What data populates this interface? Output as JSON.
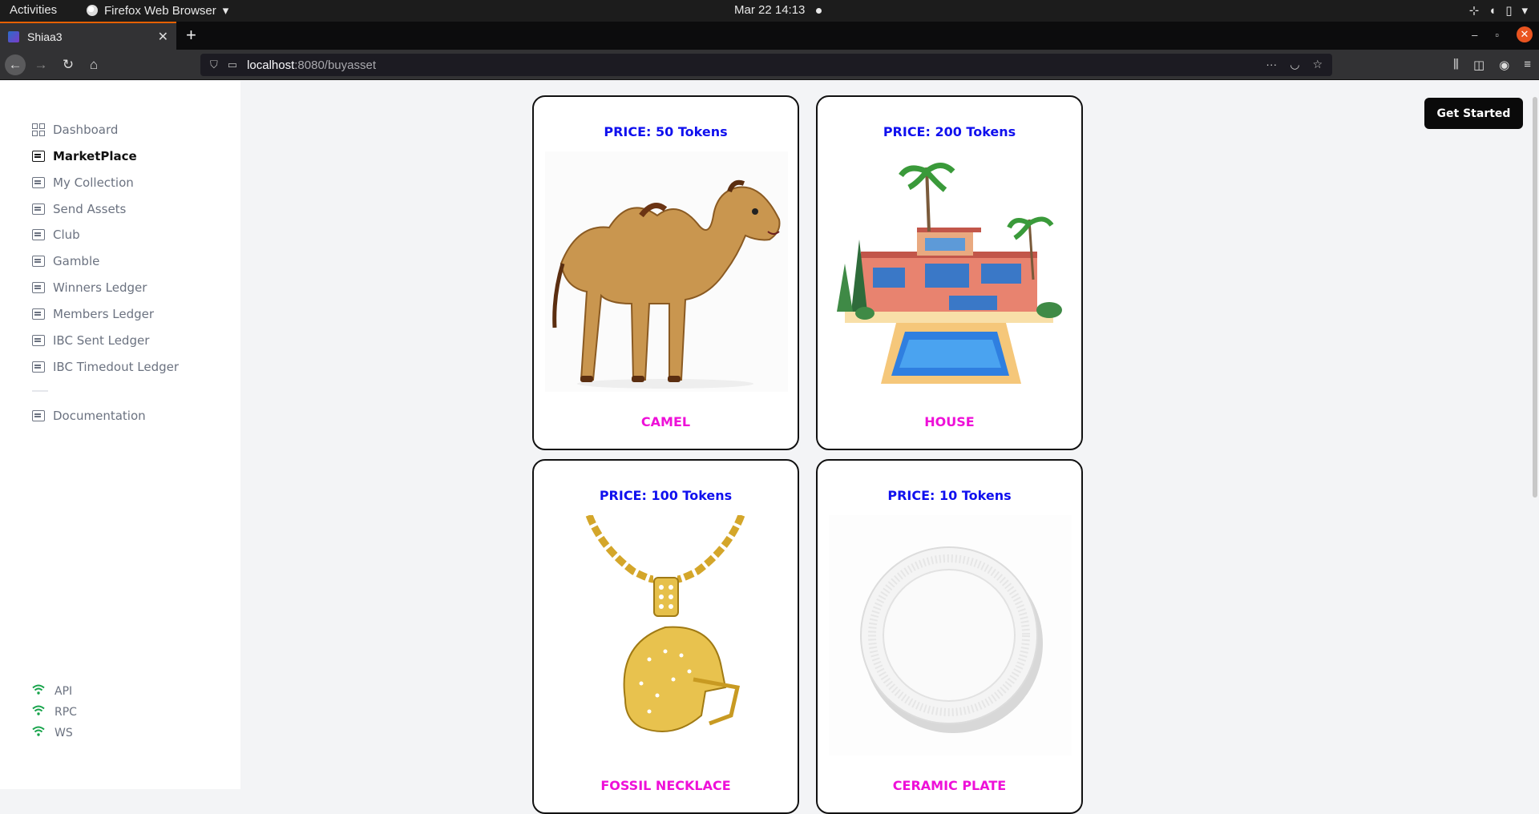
{
  "system": {
    "activities": "Activities",
    "app_menu": "Firefox Web Browser",
    "clock": "Mar 22  14:13"
  },
  "browser": {
    "tab_title": "Shiaa3",
    "url_host": "localhost",
    "url_rest": ":8080/buyasset"
  },
  "sidebar": {
    "items": [
      {
        "label": "Dashboard",
        "icon": "grid-icon",
        "active": false
      },
      {
        "label": "MarketPlace",
        "icon": "list-icon",
        "active": true
      },
      {
        "label": "My Collection",
        "icon": "list-icon",
        "active": false
      },
      {
        "label": "Send Assets",
        "icon": "list-icon",
        "active": false
      },
      {
        "label": "Club",
        "icon": "list-icon",
        "active": false
      },
      {
        "label": "Gamble",
        "icon": "list-icon",
        "active": false
      },
      {
        "label": "Winners Ledger",
        "icon": "list-icon",
        "active": false
      },
      {
        "label": "Members Ledger",
        "icon": "list-icon",
        "active": false
      },
      {
        "label": "IBC Sent Ledger",
        "icon": "list-icon",
        "active": false
      },
      {
        "label": "IBC Timedout Ledger",
        "icon": "list-icon",
        "active": false
      }
    ],
    "documentation": "Documentation",
    "connections": [
      "API",
      "RPC",
      "WS"
    ]
  },
  "header": {
    "get_started": "Get Started"
  },
  "assets": [
    {
      "price": "PRICE: 50 Tokens",
      "name": "CAMEL"
    },
    {
      "price": "PRICE: 200 Tokens",
      "name": "HOUSE"
    },
    {
      "price": "PRICE: 100 Tokens",
      "name": "FOSSIL NECKLACE"
    },
    {
      "price": "PRICE: 10 Tokens",
      "name": "CERAMIC PLATE"
    }
  ],
  "colors": {
    "price": "#1010ee",
    "name": "#ee10d8",
    "connection": "#16a34a"
  }
}
